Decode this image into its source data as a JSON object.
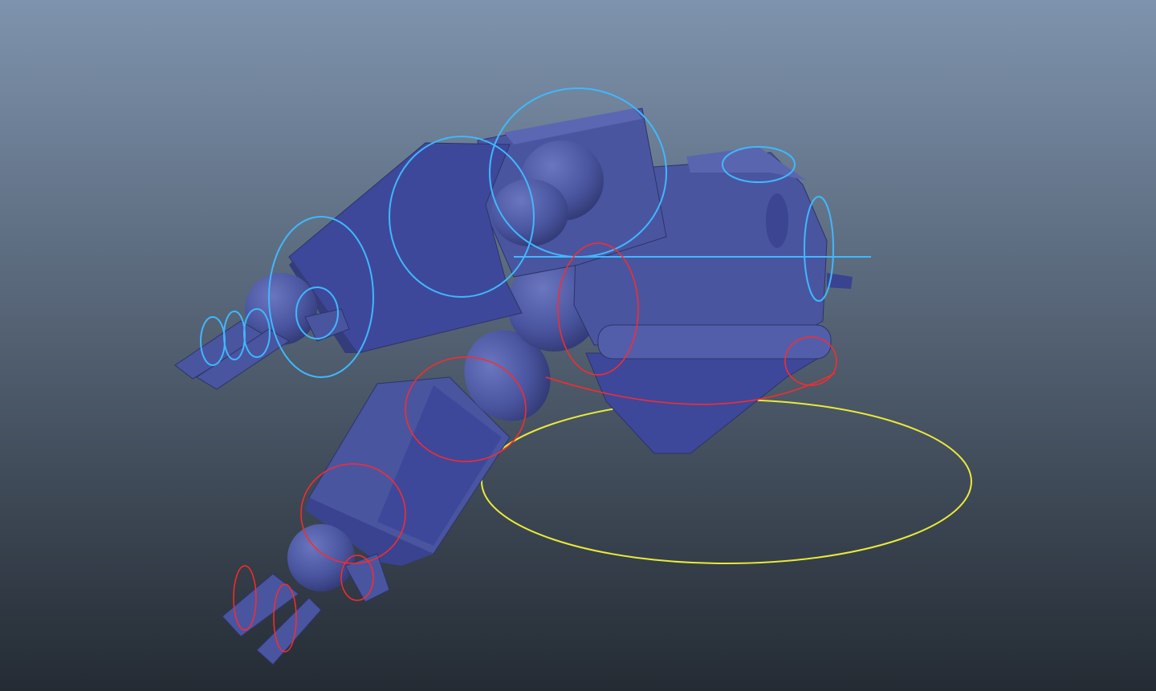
{
  "viewport": {
    "background_top": "#7e93ad",
    "background_bottom": "#242b33"
  },
  "model": {
    "shading_color": "#4a55a0",
    "shadow_color": "#343d7a",
    "highlight_color": "#6470b8"
  },
  "controls": {
    "left_side_color": "#3fb8ff",
    "right_side_color": "#ff2a2a",
    "root_color": "#eaea38"
  }
}
